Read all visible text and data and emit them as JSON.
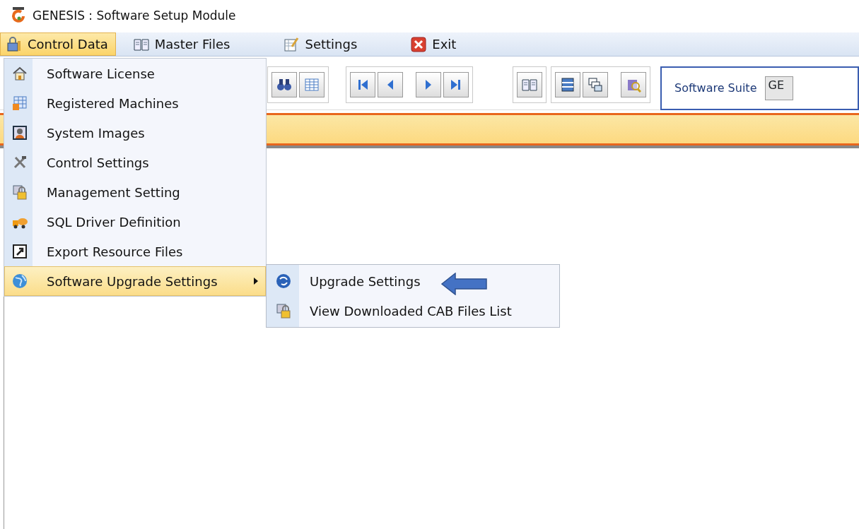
{
  "window": {
    "title": "GENESIS : Software Setup Module"
  },
  "menubar": [
    {
      "label": "Control Data",
      "selected": true
    },
    {
      "label": "Master Files",
      "selected": false
    },
    {
      "label": "Settings",
      "selected": false
    },
    {
      "label": "Exit",
      "selected": false
    }
  ],
  "dropdown": [
    {
      "label": "Software License",
      "selected": false,
      "submenu": false
    },
    {
      "label": "Registered Machines",
      "selected": false,
      "submenu": false
    },
    {
      "label": "System Images",
      "selected": false,
      "submenu": false
    },
    {
      "label": "Control Settings",
      "selected": false,
      "submenu": false
    },
    {
      "label": "Management Setting",
      "selected": false,
      "submenu": false
    },
    {
      "label": "SQL Driver Definition",
      "selected": false,
      "submenu": false
    },
    {
      "label": "Export Resource Files",
      "selected": false,
      "submenu": false
    },
    {
      "label": "Software Upgrade Settings",
      "selected": true,
      "submenu": true
    }
  ],
  "submenu": [
    {
      "label": "Upgrade Settings",
      "selected": false
    },
    {
      "label": "View Downloaded CAB Files List",
      "selected": false
    }
  ],
  "toolbar": {
    "suite_label": "Software Suite",
    "suite_value": "GE"
  }
}
